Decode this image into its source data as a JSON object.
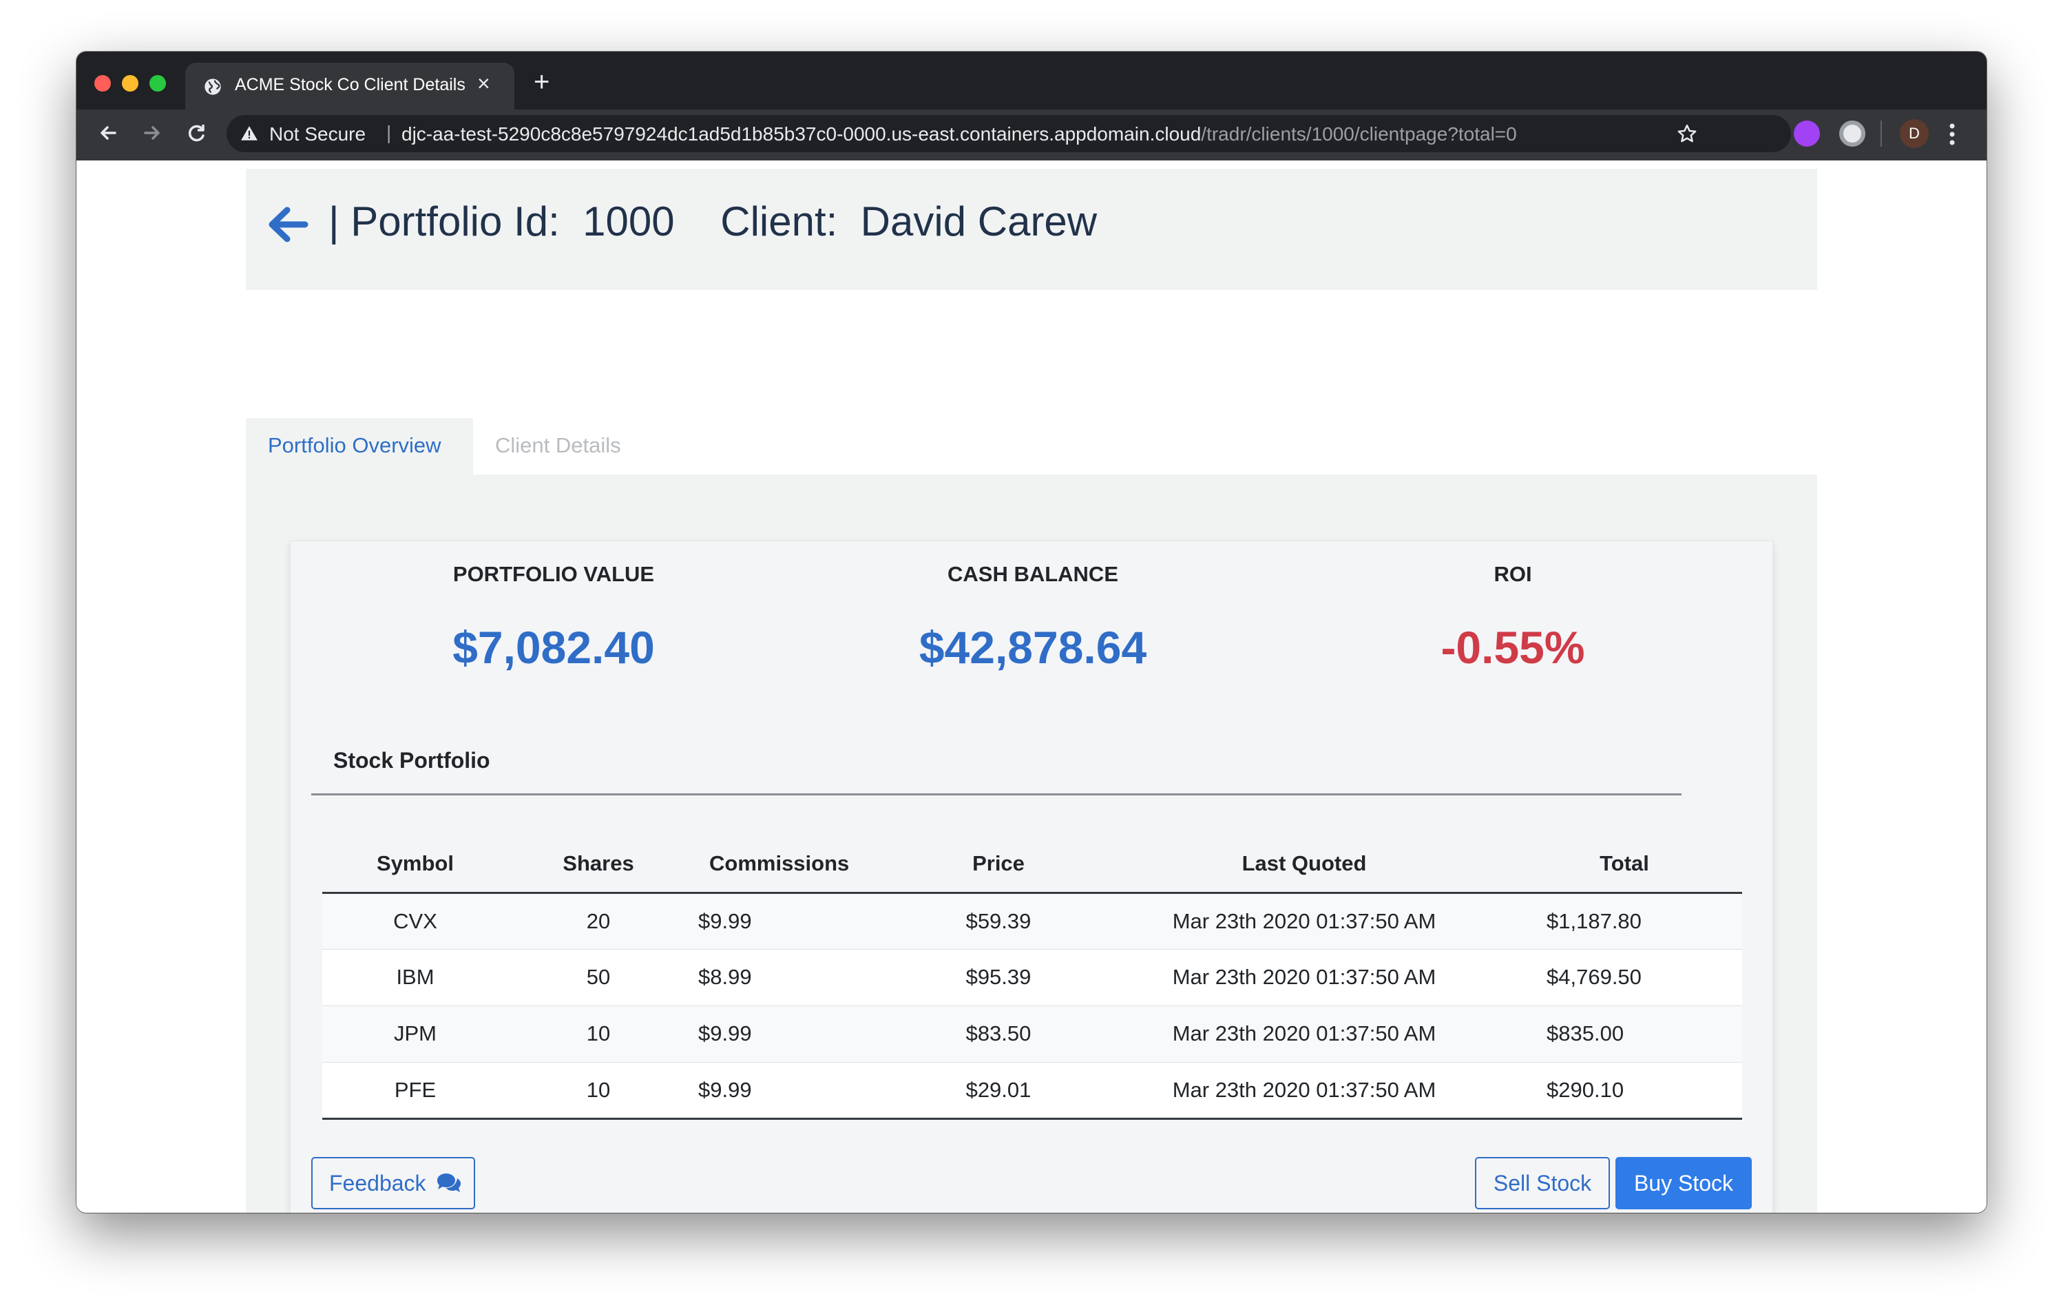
{
  "browser": {
    "tab_title": "ACME Stock Co Client Details",
    "tab_close": "×",
    "new_tab": "+",
    "security_label": "Not Secure",
    "separator": "|",
    "url_host": "djc-aa-test-5290c8c8e5797924dc1ad5d1b85b37c0-0000.us-east.containers.appdomain.cloud",
    "url_path": "/tradr/clients/1000/clientpage?total=0",
    "profile_initial": "D"
  },
  "header": {
    "prefix": "| Portfolio Id:  ",
    "portfolio_id": "1000",
    "client_label": "    Client:  ",
    "client_name": "David Carew"
  },
  "tabs": [
    {
      "label": "Portfolio Overview",
      "active": true
    },
    {
      "label": "Client Details",
      "active": false
    }
  ],
  "metrics": [
    {
      "label": "PORTFOLIO VALUE",
      "value": "$7,082.40"
    },
    {
      "label": "CASH BALANCE",
      "value": "$42,878.64"
    },
    {
      "label": "ROI",
      "value": "-0.55%"
    }
  ],
  "portfolio": {
    "title": "Stock Portfolio",
    "columns": [
      "Symbol",
      "Shares",
      "Commissions",
      "Price",
      "Last Quoted",
      "Total"
    ],
    "rows": [
      [
        "CVX",
        "20",
        "$9.99",
        "$59.39",
        "Mar 23th 2020 01:37:50 AM",
        "$1,187.80"
      ],
      [
        "IBM",
        "50",
        "$8.99",
        "$95.39",
        "Mar 23th 2020 01:37:50 AM",
        "$4,769.50"
      ],
      [
        "JPM",
        "10",
        "$9.99",
        "$83.50",
        "Mar 23th 2020 01:37:50 AM",
        "$835.00"
      ],
      [
        "PFE",
        "10",
        "$9.99",
        "$29.01",
        "Mar 23th 2020 01:37:50 AM",
        "$290.10"
      ]
    ]
  },
  "buttons": {
    "feedback": "Feedback",
    "sell": "Sell Stock",
    "buy": "Buy Stock"
  },
  "colors": {
    "accent": "#2f6dc7",
    "negative": "#cf3b47",
    "primary_button": "#2f7be8"
  },
  "icons": [
    "globe-icon",
    "warning-icon",
    "back-arrow-icon",
    "star-icon",
    "chat-icon",
    "kebab-icon"
  ]
}
